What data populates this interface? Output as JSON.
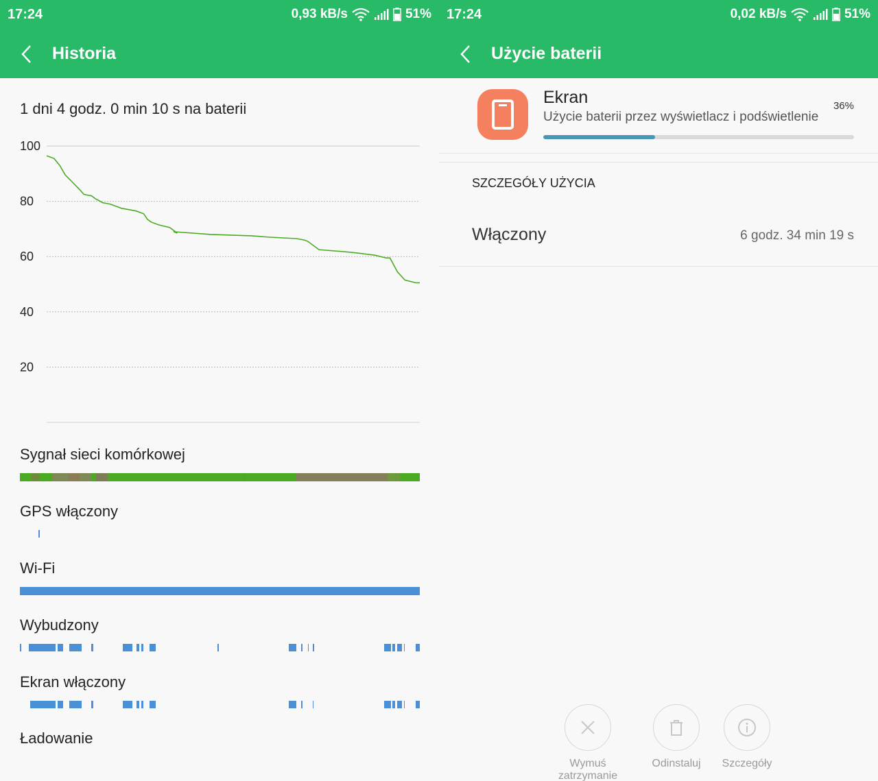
{
  "left": {
    "status": {
      "time": "17:24",
      "speed": "0,93 kB/s",
      "battery": "51%"
    },
    "title": "Historia",
    "duration": "1 dni 4 godz. 0 min 10 s na baterii",
    "chart_data": {
      "type": "line",
      "title": "",
      "xlabel": "",
      "ylabel": "",
      "ylim": [
        0,
        100
      ],
      "yticks": [
        100,
        80,
        60,
        40,
        20
      ],
      "grid": true,
      "x_range": [
        0,
        1
      ],
      "series": [
        {
          "color": "#4aab22",
          "x": [
            0,
            0.02,
            0.035,
            0.05,
            0.065,
            0.09,
            0.1,
            0.12,
            0.13,
            0.15,
            0.17,
            0.18,
            0.19,
            0.2,
            0.22,
            0.24,
            0.26,
            0.27,
            0.28,
            0.3,
            0.33,
            0.35,
            0.34,
            0.44,
            0.55,
            0.6,
            0.67,
            0.69,
            0.7,
            0.73,
            0.82,
            0.88,
            0.91,
            0.92,
            0.94,
            0.96,
            0.99,
            1
          ],
          "values": [
            96.5,
            95.5,
            93,
            89.5,
            87.5,
            84,
            82.5,
            82,
            81,
            79.5,
            79,
            78.5,
            78,
            77.5,
            77,
            76.5,
            75.5,
            73.5,
            72.5,
            71.5,
            70.5,
            68.5,
            69,
            68,
            67.5,
            67,
            66.5,
            66,
            65.5,
            62.5,
            61.5,
            60.5,
            59.5,
            59.5,
            54.5,
            51.5,
            50.5,
            50.5
          ]
        }
      ]
    },
    "tracks": [
      {
        "label": "Sygnał sieci komórkowej",
        "type": "signal",
        "color": "#4aab22",
        "segments": [
          [
            0.03,
            0.05,
            "#6f8a3a"
          ],
          [
            0.08,
            0.18,
            "#7d8a55"
          ],
          [
            0.12,
            0.15,
            "#8a7d55"
          ],
          [
            0.19,
            0.22,
            "#7d7d55"
          ],
          [
            0.56,
            0.56,
            "#6a8a40"
          ],
          [
            0.69,
            0.92,
            "#827f5a"
          ],
          [
            0.92,
            0.95,
            "#6a9a3a"
          ]
        ]
      },
      {
        "label": "GPS włączony",
        "type": "ticks",
        "color": "#4a90d6",
        "segments": [
          [
            0.047,
            0.05
          ]
        ]
      },
      {
        "label": "Wi-Fi",
        "type": "bar",
        "color": "#4a90d6",
        "segments": [
          [
            0,
            1
          ]
        ]
      },
      {
        "label": "Wybudzony",
        "type": "ticks",
        "color": "#4a90d6",
        "segments": [
          [
            0,
            0.003
          ],
          [
            0.022,
            0.09
          ],
          [
            0.095,
            0.108
          ],
          [
            0.124,
            0.155
          ],
          [
            0.178,
            0.183
          ],
          [
            0.257,
            0.282
          ],
          [
            0.292,
            0.298
          ],
          [
            0.304,
            0.308
          ],
          [
            0.325,
            0.34
          ],
          [
            0.494,
            0.497
          ],
          [
            0.673,
            0.692
          ],
          [
            0.703,
            0.706
          ],
          [
            0.72,
            0.723
          ],
          [
            0.733,
            0.736
          ],
          [
            0.91,
            0.928
          ],
          [
            0.932,
            0.938
          ],
          [
            0.943,
            0.955
          ],
          [
            0.96,
            0.962
          ],
          [
            0.99,
            1
          ]
        ]
      },
      {
        "label": "Ekran włączony",
        "type": "ticks",
        "color": "#4a90d6",
        "segments": [
          [
            0.025,
            0.09
          ],
          [
            0.095,
            0.108
          ],
          [
            0.124,
            0.155
          ],
          [
            0.178,
            0.183
          ],
          [
            0.257,
            0.282
          ],
          [
            0.292,
            0.298
          ],
          [
            0.304,
            0.308
          ],
          [
            0.325,
            0.34
          ],
          [
            0.673,
            0.692
          ],
          [
            0.703,
            0.706
          ],
          [
            0.732,
            0.735
          ],
          [
            0.91,
            0.928
          ],
          [
            0.932,
            0.938
          ],
          [
            0.943,
            0.955
          ],
          [
            0.96,
            0.962
          ],
          [
            0.99,
            1
          ]
        ]
      },
      {
        "label": "Ładowanie",
        "type": "ticks",
        "color": "#4a90d6",
        "segments": []
      }
    ]
  },
  "right": {
    "status": {
      "time": "17:24",
      "speed": "0,02 kB/s",
      "battery": "51%"
    },
    "title": "Użycie baterii",
    "app": {
      "name": "Ekran",
      "description": "Użycie baterii przez wyświetlacz i podświetlenie",
      "percent_label": "36%",
      "percent": 36,
      "icon": "tablet-icon",
      "icon_color": "#f4805f"
    },
    "section_title": "SZCZEGÓŁY UŻYCIA",
    "detail": {
      "label": "Włączony",
      "value": "6 godz. 34 min 19 s"
    },
    "actions": [
      {
        "label": "Wymuś zatrzymanie",
        "icon": "close-icon"
      },
      {
        "label": "Odinstaluj",
        "icon": "trash-icon"
      },
      {
        "label": "Szczegóły",
        "icon": "info-icon"
      }
    ]
  },
  "colors": {
    "accent": "#28ba67",
    "progress": "#4a96b8",
    "bar_blue": "#4a90d6",
    "line_green": "#4aab22"
  }
}
